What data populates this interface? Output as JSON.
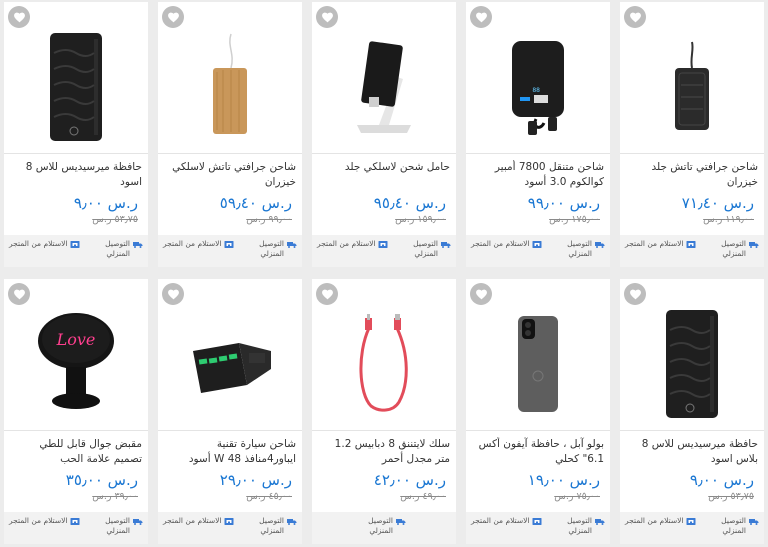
{
  "labels": {
    "delivery": "التوصيل المنزلي",
    "pickup": "الاستلام من المتجر"
  },
  "colors": {
    "price": "#1976d2",
    "wishlist": "#bdbdbd"
  },
  "products": [
    {
      "title": "شاحن جرافتي تاتش جلد خيزران",
      "price": "ر.س ٧١٫٤٠",
      "old_price": "١١٩٫٠٠ ر.س",
      "icon": "wireless-charger-pad-black",
      "pickup": true
    },
    {
      "title": "شاحن متنقل 7800 أمبير كوالكوم 3.0 أسود",
      "price": "ر.س ٩٩٫٠٠",
      "old_price": "١٧٥٫٠٠ ر.س",
      "icon": "power-bank",
      "pickup": true
    },
    {
      "title": "حامل شحن لاسلكي جلد",
      "price": "ر.س ٩٥٫٤٠",
      "old_price": "١٥٩٫٠٠ ر.س",
      "icon": "wireless-charging-stand",
      "pickup": true
    },
    {
      "title": "شاحن جرافتي تاتش لاسلكي خيزران",
      "price": "ر.س ٥٩٫٤٠",
      "old_price": "٩٩٫٠٠ ر.س",
      "icon": "bamboo-charger",
      "pickup": true
    },
    {
      "title": "حافظة ميرسيديس للاس 8 اسود",
      "price": "ر.س ٩٫٠٠",
      "old_price": "٥٣٫٧٥ ر.س",
      "icon": "phone-case-folio",
      "pickup": true
    },
    {
      "title": "حافظة ميرسيديس للاس 8 بلاس اسود",
      "price": "ر.س ٩٫٠٠",
      "old_price": "٥٣٫٧٥ ر.س",
      "icon": "phone-case-folio",
      "pickup": true
    },
    {
      "title": "بولو آبل ، حافظة آيفون أكس 6.1\" كحلي",
      "price": "ر.س ١٩٫٠٠",
      "old_price": "٧٥٫٠٠ ر.س",
      "icon": "iphone-case-grey",
      "pickup": true
    },
    {
      "title": "سلك لايتننق 8 دبابيس 1.2 متر مجدل أحمر",
      "price": "ر.س ٤٢٫٠٠",
      "old_price": "٤٩٫٠٠ ر.س",
      "icon": "lightning-cable-red",
      "pickup": false
    },
    {
      "title": "شاحن سيارة تقنية ايباور4منافذ 48 W أسود",
      "price": "ر.س ٢٩٫٠٠",
      "old_price": "٤٥٫٠٠ ر.س",
      "icon": "car-charger",
      "pickup": true
    },
    {
      "title": "مقبض جوال قابل للطي تصميم علامة الحب",
      "price": "ر.س ٣٥٫٠٠",
      "old_price": "٣٩٫٠٠ ر.س",
      "icon": "phone-grip-love",
      "pickup": true
    }
  ]
}
